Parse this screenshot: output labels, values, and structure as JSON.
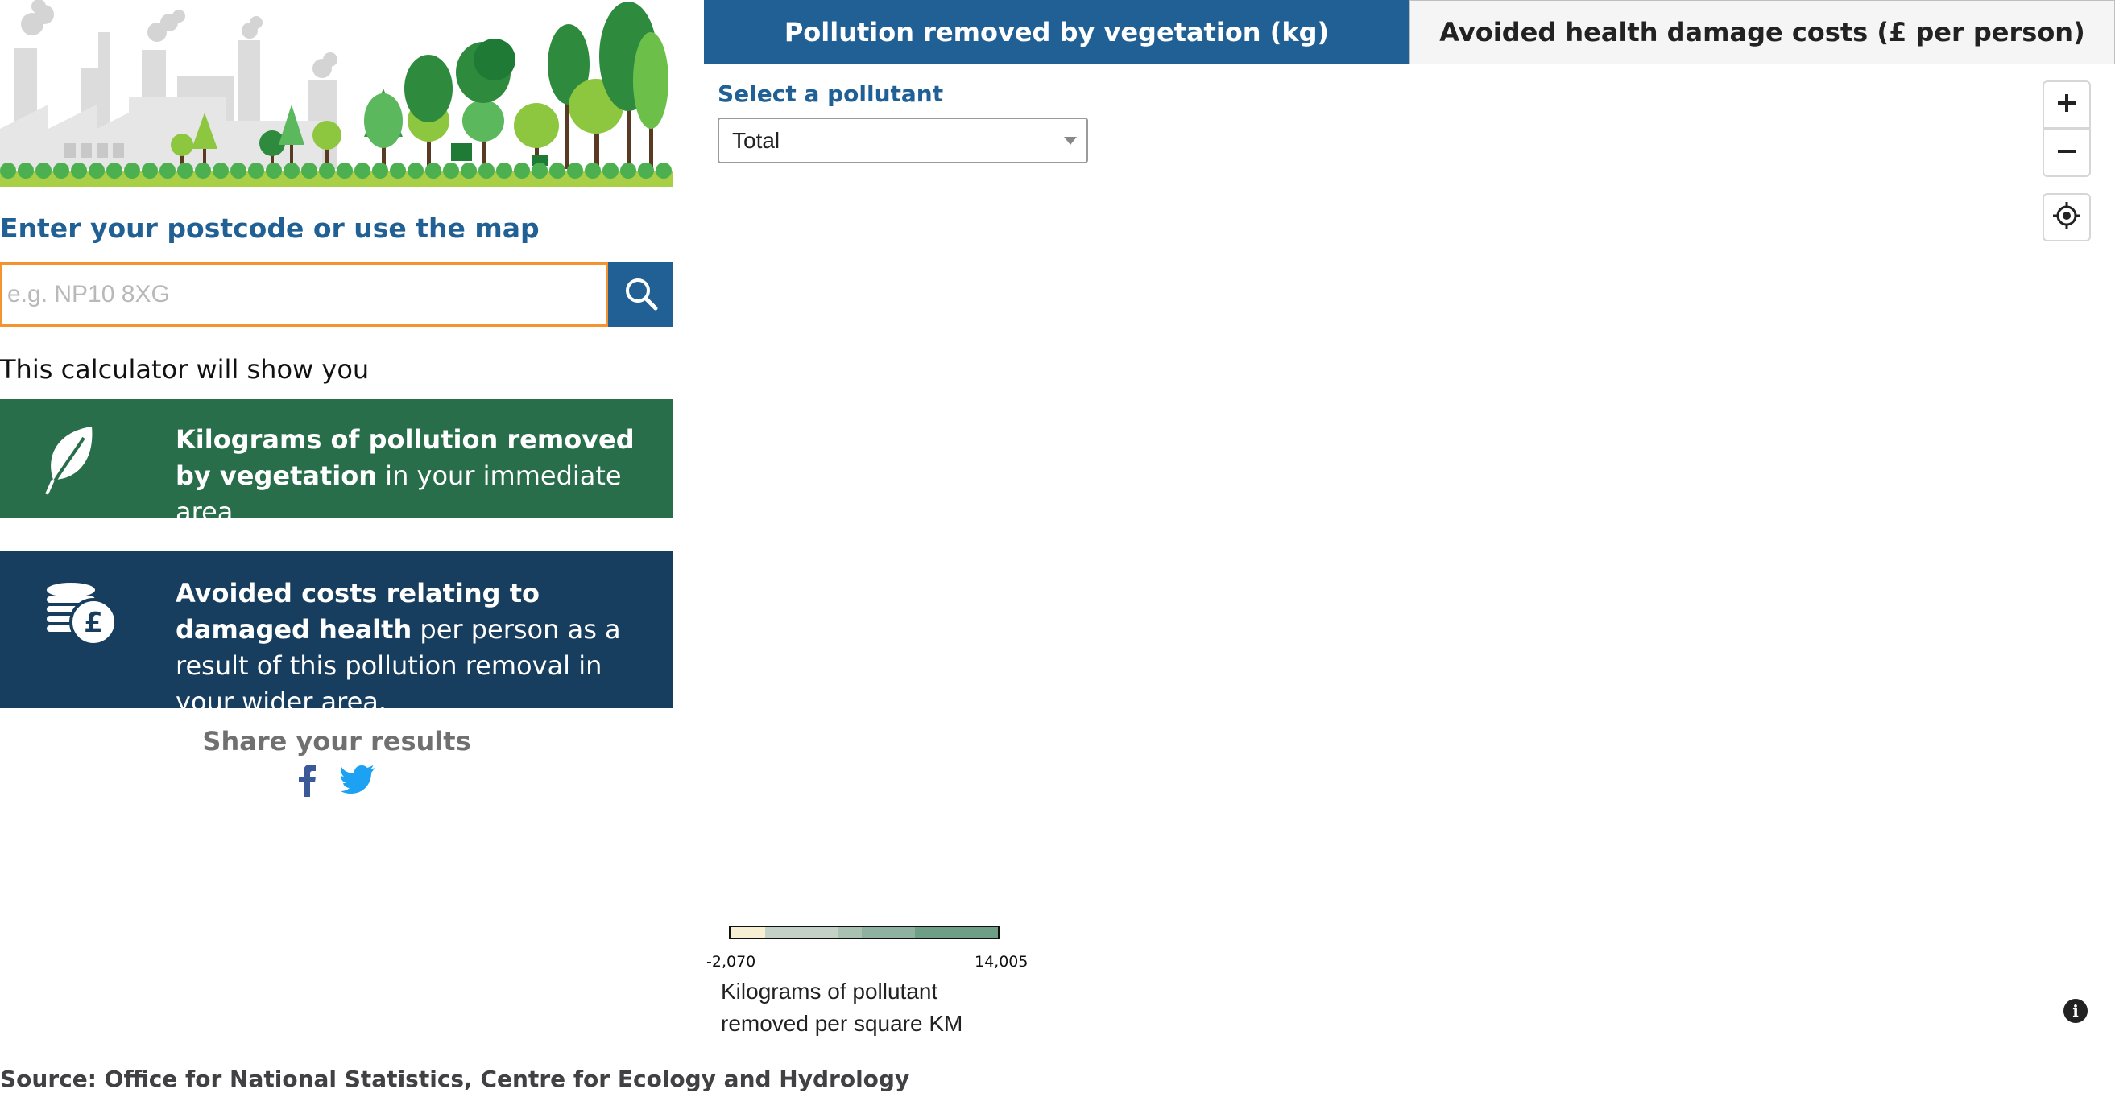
{
  "left_panel": {
    "postcode_heading": "Enter your postcode or use the map",
    "search": {
      "placeholder": "e.g. NP10 8XG",
      "value": ""
    },
    "intro": "This calculator will show you",
    "vegetation_box": {
      "bold_text": "Kilograms of pollution removed by vegetation",
      "normal_text": " in your immediate area."
    },
    "health_box": {
      "bold_text": "Avoided costs relating to damaged health",
      "normal_text": " per person as a result of this pollution removal in your wider area."
    },
    "share": {
      "heading": "Share your results"
    },
    "source": "Source: Office for National Statistics, Centre for Ecology and Hydrology"
  },
  "tabs": [
    {
      "label": "Pollution removed by vegetation (kg)",
      "active": true
    },
    {
      "label": "Avoided health damage costs (£ per person)",
      "active": false
    }
  ],
  "pollutant": {
    "label": "Select a pollutant",
    "selected": "Total"
  },
  "map_controls": {
    "zoom_in": "+",
    "zoom_out": "−"
  },
  "legend": {
    "min_label": "-2,070",
    "max_label": "14,005",
    "title": "Kilograms of pollutant removed per square KM",
    "colors": [
      "#f6efd3",
      "#c3d1c6",
      "#a8c1b1",
      "#8fb2a0",
      "#6f9e86"
    ]
  },
  "colors": {
    "accent_blue": "#206095",
    "vegetation_green": "#286e4b",
    "health_navy": "#173e5e",
    "input_border": "#f39431",
    "facebook": "#3b5998",
    "twitter": "#1da1f2"
  },
  "icons": {
    "search": "search-icon",
    "leaf": "leaf-icon",
    "coins": "pound-coins-icon",
    "facebook": "facebook-icon",
    "twitter": "twitter-icon",
    "locate": "crosshair-icon",
    "info": "info-icon"
  }
}
